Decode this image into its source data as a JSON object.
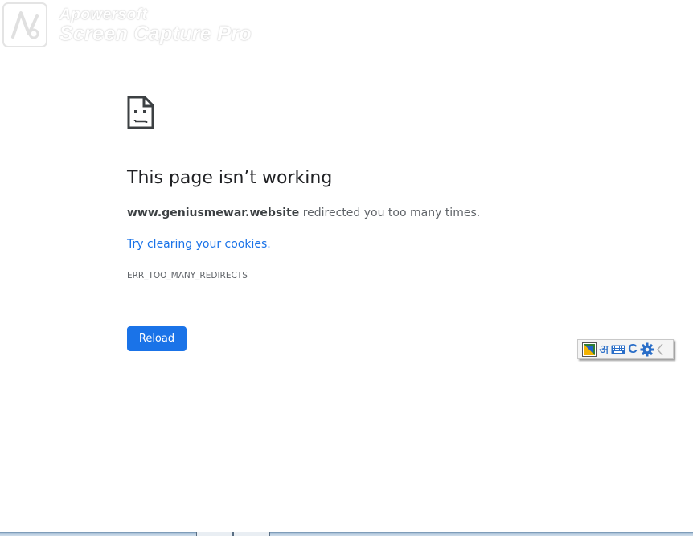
{
  "watermark": {
    "line1": "Apowersoft",
    "line2": "Screen Capture Pro"
  },
  "error": {
    "icon": "sad-page-icon",
    "heading": "This page isn’t working",
    "host": "www.geniusmewar.website",
    "message": " redirected you too many times.",
    "suggestion": "Try clearing your cookies.",
    "code": "ERR_TOO_MANY_REDIRECTS",
    "reload_label": "Reload"
  },
  "ime_toolbar": {
    "logo_icon": "input-tools-icon",
    "language_glyph": "अ",
    "keyboard_icon": "keyboard-icon",
    "c_glyph": "C",
    "settings_icon": "gear-icon"
  },
  "colors": {
    "link": "#1a73e8",
    "button_bg": "#1a73e8",
    "heading": "#202124",
    "body_text": "#5f6368"
  }
}
